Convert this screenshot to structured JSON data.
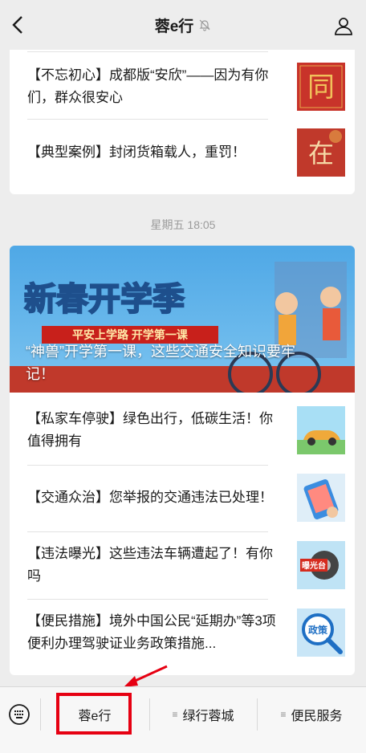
{
  "navbar": {
    "title": "蓉e行"
  },
  "section1": {
    "items": [
      {
        "text": "【不忘初心】成都版“安欣”——因为有你们，群众很安心",
        "thumb_char": "同"
      },
      {
        "text": "【典型案例】封闭货箱载人，重罚！",
        "thumb_char": "在"
      }
    ]
  },
  "timestamp": "星期五 18:05",
  "section2": {
    "banner": {
      "title": "新春开学季",
      "subtitle": "平安上学路 开学第一课",
      "caption": "“神兽”开学第一课，这些交通安全知识要牢记！"
    },
    "items": [
      {
        "text": "【私家车停驶】绿色出行，低碳生活！你值得拥有"
      },
      {
        "text": "【交通众治】您举报的交通违法已处理！"
      },
      {
        "text": "【违法曝光】这些违法车辆遭起了！有你吗",
        "thumb_label": "曝光台"
      },
      {
        "text": "【便民措施】境外中国公民“延期办”等3项便利办理驾驶证业务政策措施...",
        "thumb_label": "政策"
      }
    ]
  },
  "bottom_menu": {
    "items": [
      {
        "label": "蓉e行"
      },
      {
        "label": "绿行蓉城"
      },
      {
        "label": "便民服务"
      }
    ]
  }
}
